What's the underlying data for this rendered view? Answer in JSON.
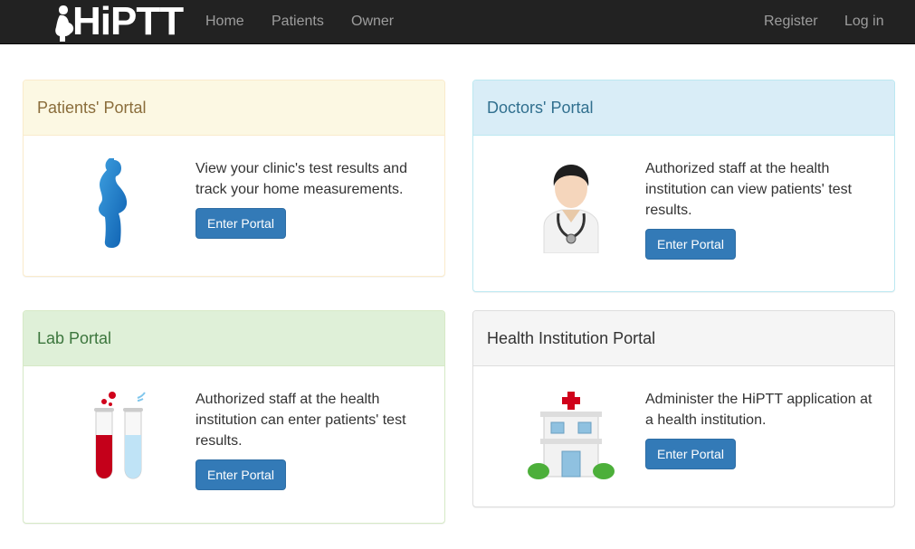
{
  "brand": {
    "name": "HiPTT"
  },
  "nav": {
    "left": [
      "Home",
      "Patients",
      "Owner"
    ],
    "right": [
      "Register",
      "Log in"
    ]
  },
  "portals": {
    "patients": {
      "title": "Patients' Portal",
      "description": "View your clinic's test results and track your home measurements.",
      "button": "Enter Portal"
    },
    "doctors": {
      "title": "Doctors' Portal",
      "description": "Authorized staff at the health institution can view patients' test results.",
      "button": "Enter Portal"
    },
    "lab": {
      "title": "Lab Portal",
      "description": "Authorized staff at the health institution can enter patients' test results.",
      "button": "Enter Portal"
    },
    "institution": {
      "title": "Health Institution Portal",
      "description": "Administer the HiPTT application at a health institution.",
      "button": "Enter Portal"
    }
  }
}
